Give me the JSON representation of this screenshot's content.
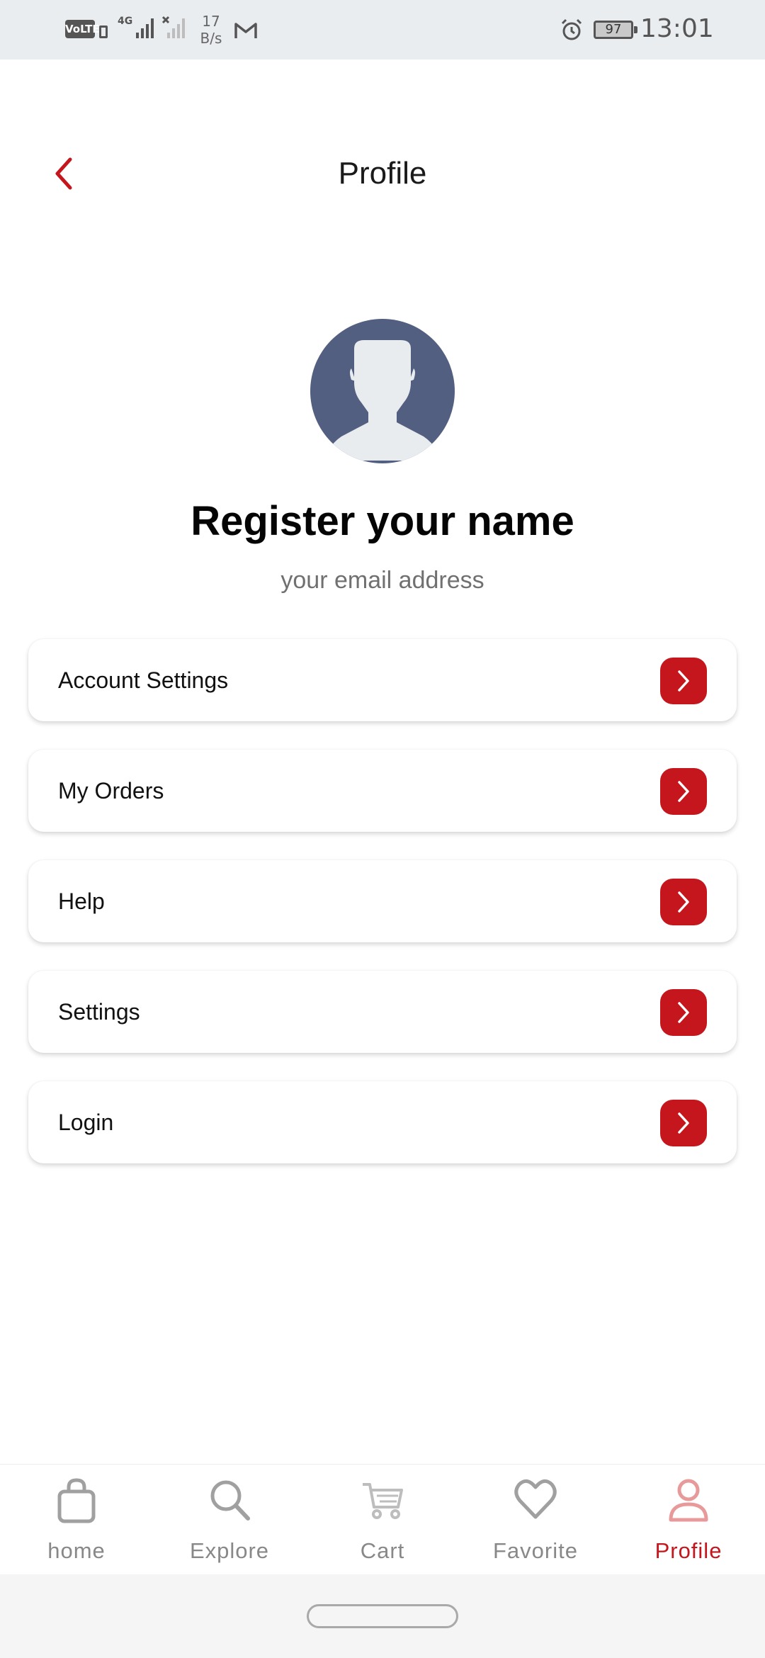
{
  "status_bar": {
    "volte": "VoLTE",
    "network": "4G",
    "speed": "17\nB/s",
    "battery": "97",
    "time": "13:01"
  },
  "header": {
    "title": "Profile",
    "back_icon": "chevron-left-icon"
  },
  "profile": {
    "name": "Register your name",
    "email": "your email address"
  },
  "menu": [
    {
      "label": "Account Settings"
    },
    {
      "label": "My Orders"
    },
    {
      "label": "Help"
    },
    {
      "label": "Settings"
    },
    {
      "label": "Login"
    }
  ],
  "nav": [
    {
      "label": "home",
      "icon": "shopping-bag-icon",
      "active": false
    },
    {
      "label": "Explore",
      "icon": "search-icon",
      "active": false
    },
    {
      "label": "Cart",
      "icon": "cart-icon",
      "active": false
    },
    {
      "label": "Favorite",
      "icon": "heart-icon",
      "active": false
    },
    {
      "label": "Profile",
      "icon": "person-icon",
      "active": true
    }
  ],
  "colors": {
    "accent": "#c4161c",
    "avatar_bg": "#535f80",
    "inactive": "#888888",
    "active_icon": "#e89a9a"
  }
}
